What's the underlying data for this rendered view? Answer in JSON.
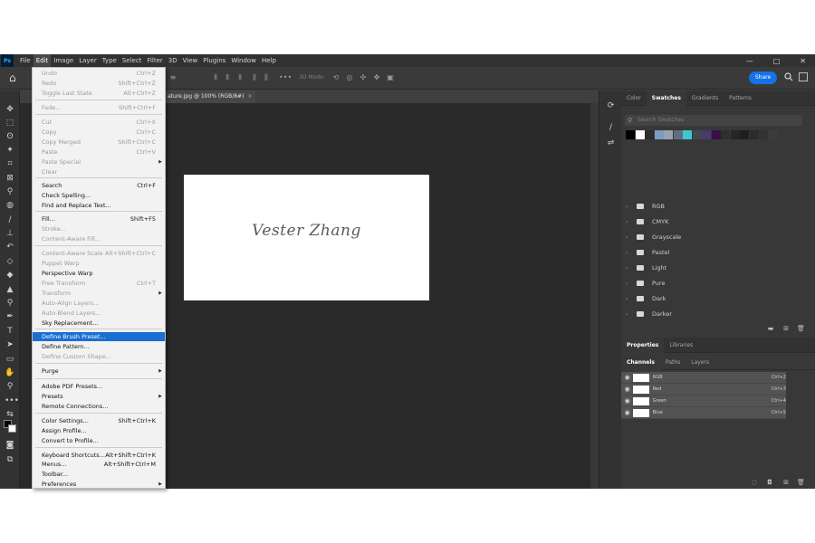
{
  "menubar": {
    "logo": "Ps",
    "items": [
      "File",
      "Edit",
      "Image",
      "Layer",
      "Type",
      "Select",
      "Filter",
      "3D",
      "View",
      "Plugins",
      "Window",
      "Help"
    ],
    "window_controls": [
      "—",
      "□",
      "✕"
    ]
  },
  "options": {
    "mode_3d": "3D Mode:",
    "share_label": "Share"
  },
  "document": {
    "tab_title": "ature.jpg @ 100% (RGB/8#)",
    "signature_text": "Vester Zhang"
  },
  "edit_menu": {
    "items": [
      {
        "label": "Undo",
        "shortcut": "Ctrl+Z",
        "disabled": true
      },
      {
        "label": "Redo",
        "shortcut": "Shift+Ctrl+Z",
        "disabled": true
      },
      {
        "label": "Toggle Last State",
        "shortcut": "Alt+Ctrl+Z",
        "disabled": true
      },
      {
        "label": "Fade...",
        "shortcut": "Shift+Ctrl+F",
        "disabled": true
      },
      {
        "label": "Cut",
        "shortcut": "Ctrl+X",
        "disabled": true
      },
      {
        "label": "Copy",
        "shortcut": "Ctrl+C",
        "disabled": true
      },
      {
        "label": "Copy Merged",
        "shortcut": "Shift+Ctrl+C",
        "disabled": true
      },
      {
        "label": "Paste",
        "shortcut": "Ctrl+V",
        "disabled": true
      },
      {
        "label": "Paste Special",
        "shortcut": "",
        "disabled": true,
        "submenu": true
      },
      {
        "label": "Clear",
        "shortcut": "",
        "disabled": true
      },
      {
        "label": "Search",
        "shortcut": "Ctrl+F",
        "disabled": false
      },
      {
        "label": "Check Spelling...",
        "shortcut": "",
        "disabled": false
      },
      {
        "label": "Find and Replace Text...",
        "shortcut": "",
        "disabled": false
      },
      {
        "label": "Fill...",
        "shortcut": "Shift+F5",
        "disabled": false
      },
      {
        "label": "Stroke...",
        "shortcut": "",
        "disabled": true
      },
      {
        "label": "Content-Aware Fill...",
        "shortcut": "",
        "disabled": true
      },
      {
        "label": "Content-Aware Scale",
        "shortcut": "Alt+Shift+Ctrl+C",
        "disabled": true
      },
      {
        "label": "Puppet Warp",
        "shortcut": "",
        "disabled": true
      },
      {
        "label": "Perspective Warp",
        "shortcut": "",
        "disabled": false
      },
      {
        "label": "Free Transform",
        "shortcut": "Ctrl+T",
        "disabled": true
      },
      {
        "label": "Transform",
        "shortcut": "",
        "disabled": true,
        "submenu": true
      },
      {
        "label": "Auto-Align Layers...",
        "shortcut": "",
        "disabled": true
      },
      {
        "label": "Auto-Blend Layers...",
        "shortcut": "",
        "disabled": true
      },
      {
        "label": "Sky Replacement...",
        "shortcut": "",
        "disabled": false
      },
      {
        "label": "Define Brush Preset...",
        "shortcut": "",
        "disabled": false,
        "highlighted": true
      },
      {
        "label": "Define Pattern...",
        "shortcut": "",
        "disabled": false
      },
      {
        "label": "Define Custom Shape...",
        "shortcut": "",
        "disabled": true
      },
      {
        "label": "Purge",
        "shortcut": "",
        "disabled": false,
        "submenu": true
      },
      {
        "label": "Adobe PDF Presets...",
        "shortcut": "",
        "disabled": false
      },
      {
        "label": "Presets",
        "shortcut": "",
        "disabled": false,
        "submenu": true
      },
      {
        "label": "Remote Connections...",
        "shortcut": "",
        "disabled": false
      },
      {
        "label": "Color Settings...",
        "shortcut": "Shift+Ctrl+K",
        "disabled": false
      },
      {
        "label": "Assign Profile...",
        "shortcut": "",
        "disabled": false
      },
      {
        "label": "Convert to Profile...",
        "shortcut": "",
        "disabled": false
      },
      {
        "label": "Keyboard Shortcuts...",
        "shortcut": "Alt+Shift+Ctrl+K",
        "disabled": false
      },
      {
        "label": "Menus...",
        "shortcut": "Alt+Shift+Ctrl+M",
        "disabled": false
      },
      {
        "label": "Toolbar...",
        "shortcut": "",
        "disabled": false
      },
      {
        "label": "Preferences",
        "shortcut": "",
        "disabled": false,
        "submenu": true
      }
    ]
  },
  "swatches_panel": {
    "tabs": [
      "Color",
      "Swatches",
      "Gradients",
      "Patterns"
    ],
    "active_tab": "Swatches",
    "search_placeholder": "Search Swatches",
    "recent_colors": [
      "#000000",
      "#ffffff",
      "#2d2d2d",
      "#7f9ac4",
      "#9aa4b0",
      "#5c6e80",
      "#3fc7cf",
      "#41484e",
      "#4a3a6a",
      "#3a0e4a",
      "#2f2f2f",
      "#262626",
      "#1f1f1f",
      "#2b2b2b",
      "#333333",
      "#3c3c3c"
    ],
    "folders": [
      "RGB",
      "CMYK",
      "Grayscale",
      "Pastel",
      "Light",
      "Pure",
      "Dark",
      "Darker"
    ]
  },
  "properties_panel": {
    "tabs": [
      "Properties",
      "Libraries"
    ],
    "active_tab": "Properties"
  },
  "channels_panel": {
    "tabs": [
      "Channels",
      "Paths",
      "Layers"
    ],
    "active_tab": "Channels",
    "channels": [
      {
        "name": "RGB",
        "shortcut": "Ctrl+2"
      },
      {
        "name": "Red",
        "shortcut": "Ctrl+3"
      },
      {
        "name": "Green",
        "shortcut": "Ctrl+4"
      },
      {
        "name": "Blue",
        "shortcut": "Ctrl+5"
      }
    ]
  }
}
